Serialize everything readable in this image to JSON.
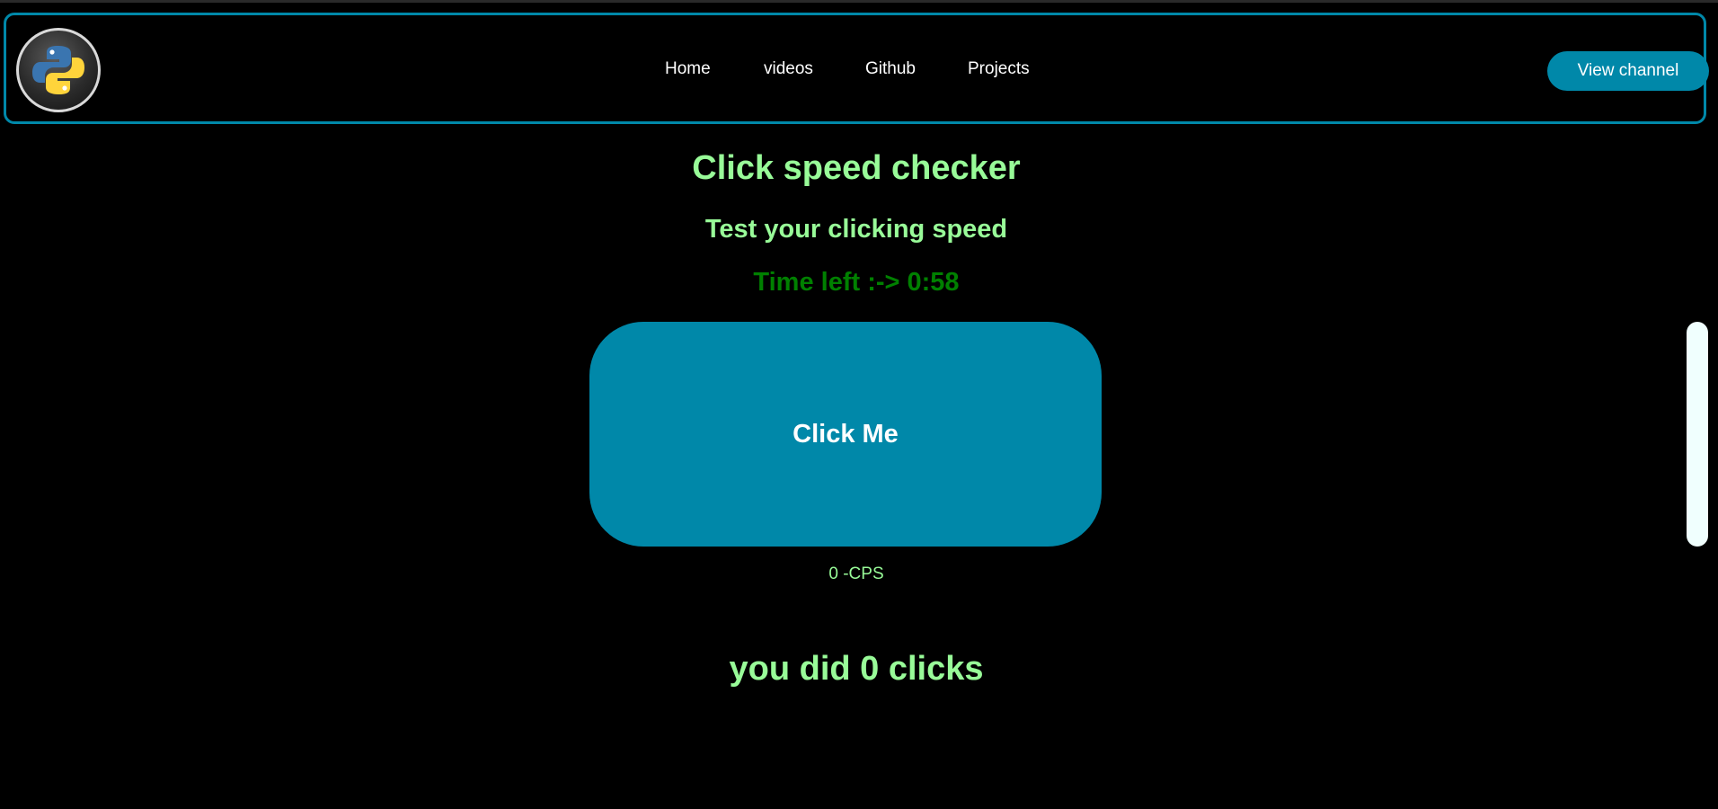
{
  "navbar": {
    "links": [
      "Home",
      "videos",
      "Github",
      "Projects"
    ],
    "channel_button": "View channel"
  },
  "main": {
    "title": "Click speed checker",
    "subtitle": "Test your clicking speed",
    "timer": "Time left :-> 0:58",
    "click_button": "Click Me",
    "cps": "0 -CPS",
    "clicks_result": "you did 0 clicks"
  },
  "colors": {
    "accent": "#0088a9",
    "text_green": "#98fb98",
    "timer_green": "#008000",
    "background": "#000000"
  },
  "icons": {
    "logo": "python-logo-icon"
  }
}
